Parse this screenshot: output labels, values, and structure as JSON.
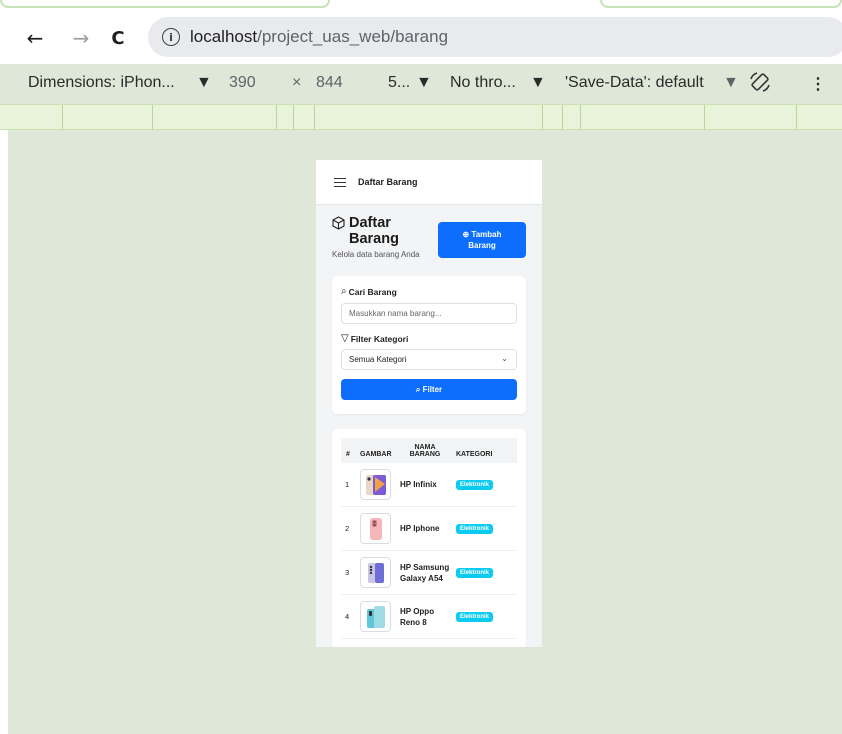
{
  "browser": {
    "url_host": "localhost",
    "url_path": "/project_uas_web/barang",
    "back_glyph": "←",
    "forward_glyph": "→",
    "reload_glyph": "C",
    "info_glyph": "i"
  },
  "devtools": {
    "device": "Dimensions: iPhon...",
    "width": "390",
    "times": "×",
    "height": "844",
    "zoom": "5...",
    "throttle": "No thro...",
    "save_data": "'Save-Data': default",
    "more": "⋮",
    "caret": "▼"
  },
  "app": {
    "appbar_title": "Daftar Barang",
    "page_title_line1": "Daftar",
    "page_title_line2": "Barang",
    "subtitle": "Kelola data barang Anda",
    "add_button_line1": "⊕ Tambah",
    "add_button_line2": "Barang",
    "search_label": "Cari Barang",
    "search_placeholder": "Masukkan nama barang...",
    "filter_label": "Filter Kategori",
    "category_selected": "Semua Kategori",
    "filter_button": "Filter",
    "table": {
      "headers": [
        "#",
        "GAMBAR",
        "NAMA BARANG",
        "KATEGORI"
      ],
      "rows": [
        {
          "no": "1",
          "name": "HP Infinix",
          "category": "Elektronik"
        },
        {
          "no": "2",
          "name": "HP Iphone",
          "category": "Elektronik"
        },
        {
          "no": "3",
          "name": "HP Samsung Galaxy A54",
          "category": "Elektronik"
        },
        {
          "no": "4",
          "name": "HP Oppo Reno 8",
          "category": "Elektronik"
        }
      ]
    }
  },
  "colors": {
    "primary": "#0d6efd",
    "badge": "#0dcaf0",
    "page_background": "#dfe8d8"
  },
  "icons": [
    "back-arrow-icon",
    "forward-arrow-icon",
    "reload-icon",
    "info-icon",
    "rotate-icon",
    "more-vert-icon",
    "menu-icon",
    "box-icon",
    "plus-circle-icon",
    "search-icon",
    "filter-icon",
    "chevron-down-icon"
  ]
}
